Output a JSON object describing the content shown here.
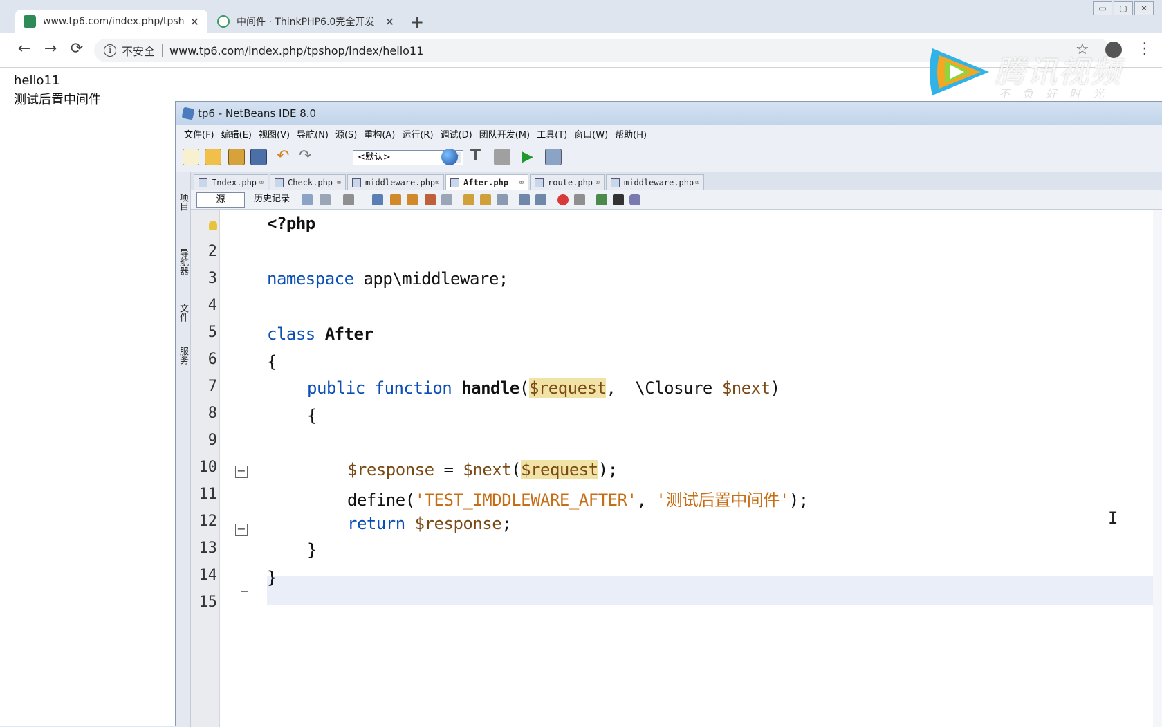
{
  "browser": {
    "window_buttons": [
      "▭",
      "▢",
      "✕"
    ],
    "tabs": [
      {
        "title": "www.tp6.com/index.php/tpsh",
        "favicon_color": "#2e8b57",
        "close": "✕"
      },
      {
        "title": "中间件 · ThinkPHP6.0完全开发",
        "favicon_color": "#3c9a5f",
        "close": "✕"
      }
    ],
    "new_tab": "+",
    "nav": {
      "back": "←",
      "forward": "→",
      "reload": "⟳"
    },
    "address": {
      "info": "i",
      "security": "不安全",
      "url": "www.tp6.com/index.php/tpshop/index/hello11"
    },
    "star": "☆",
    "menu": "⋮"
  },
  "page": {
    "lines": [
      "hello11",
      "测试后置中间件"
    ]
  },
  "watermark": {
    "brand": "腾讯视频",
    "slogan": "不负好时光"
  },
  "ide": {
    "title": "tp6 - NetBeans IDE 8.0",
    "menu": [
      "文件(F)",
      "编辑(E)",
      "视图(V)",
      "导航(N)",
      "源(S)",
      "重构(A)",
      "运行(R)",
      "调试(D)",
      "团队开发(M)",
      "工具(T)",
      "窗口(W)",
      "帮助(H)"
    ],
    "config_combo": "<默认>",
    "side_panels": [
      "项目",
      "导航器",
      "文件",
      "服务"
    ],
    "editor_tabs": [
      {
        "name": "Index.php",
        "active": false
      },
      {
        "name": "Check.php",
        "active": false
      },
      {
        "name": "middleware.php",
        "active": false
      },
      {
        "name": "After.php",
        "active": true
      },
      {
        "name": "route.php",
        "active": false
      },
      {
        "name": "middleware.php",
        "active": false
      }
    ],
    "tab_close": "⌧",
    "source_tab": "源",
    "history_tab": "历史记录",
    "line_numbers": [
      "",
      "2",
      "3",
      "4",
      "5",
      "6",
      "7",
      "8",
      "9",
      "10",
      "11",
      "12",
      "13",
      "14",
      "15"
    ],
    "code": {
      "l1": "<?php",
      "l3_kw": "namespace",
      "l3_rest": " app\\middleware;",
      "l5_kw": "class",
      "l5_name": "After",
      "l6": "{",
      "l7_kw": "public function ",
      "l7_fn": "handle",
      "l7_p1": "(",
      "l7_var1": "$request",
      "l7_p2": ",  \\Closure ",
      "l7_var2": "$next",
      "l7_p3": ")",
      "l8": "{",
      "l10_var1": "$response",
      "l10_eq": " = ",
      "l10_var2": "$next",
      "l10_p1": "(",
      "l10_var3": "$request",
      "l10_p2": ");",
      "l11_fn": "define(",
      "l11_s1": "'TEST_IMDDLEWARE_AFTER'",
      "l11_c": ", ",
      "l11_s2": "'测试后置中间件'",
      "l11_end": ");",
      "l12_kw": "return ",
      "l12_var": "$response",
      "l12_end": ";",
      "l13": "}",
      "l14": "}"
    },
    "cursor": "I"
  },
  "colors": {
    "keyword": "#0b4fb6",
    "variable": "#7a4a16",
    "string": "#c76d14",
    "highlight": "#f1e2a5",
    "current_line": "#e9eef8"
  }
}
